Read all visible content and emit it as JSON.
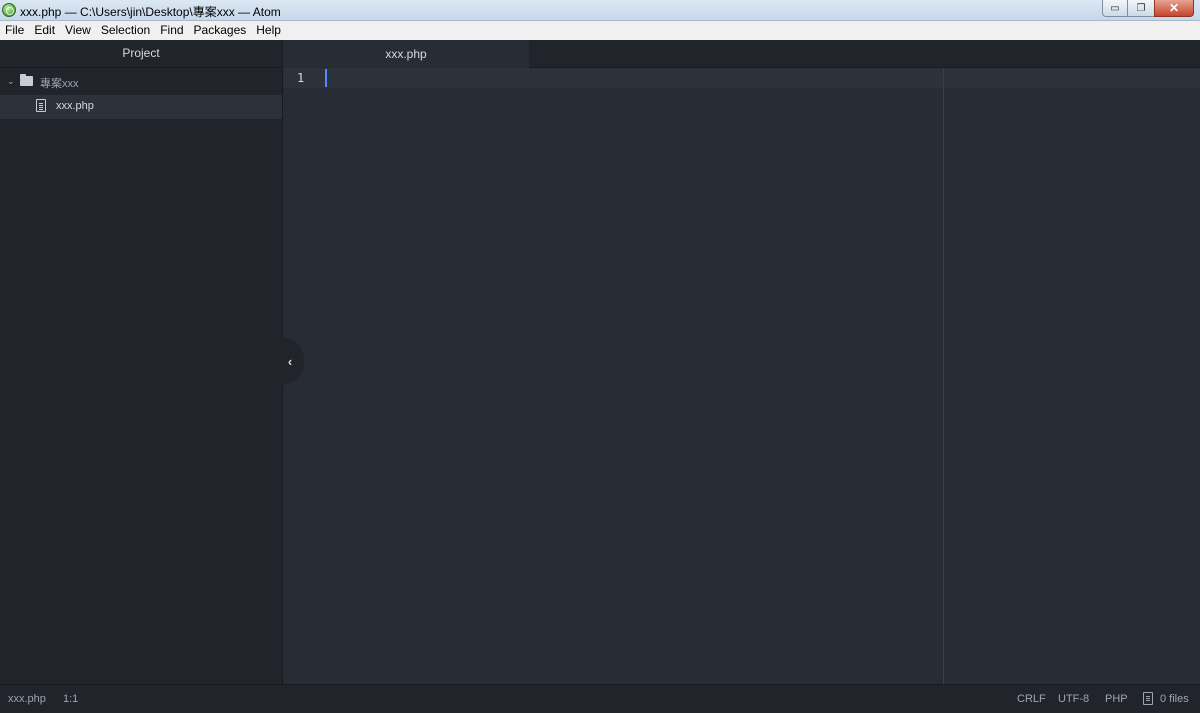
{
  "window": {
    "title": "xxx.php — C:\\Users\\jin\\Desktop\\專案xxx — Atom",
    "minimize_glyph": "▭",
    "maximize_glyph": "❐",
    "close_glyph": "✕"
  },
  "menu": [
    "File",
    "Edit",
    "View",
    "Selection",
    "Find",
    "Packages",
    "Help"
  ],
  "tree": {
    "header": "Project",
    "folder": "專案xxx",
    "file": "xxx.php"
  },
  "tabs": [
    {
      "label": "xxx.php"
    }
  ],
  "editor": {
    "line_number": "1"
  },
  "toggle": {
    "glyph": "‹"
  },
  "status": {
    "file": "xxx.php",
    "position": "1:1",
    "line_ending": "CRLF",
    "encoding": "UTF-8",
    "grammar": "PHP",
    "files": "0 files"
  },
  "colors": {
    "accent": "#528bff",
    "background": "#282c34",
    "panel": "#21252b"
  }
}
